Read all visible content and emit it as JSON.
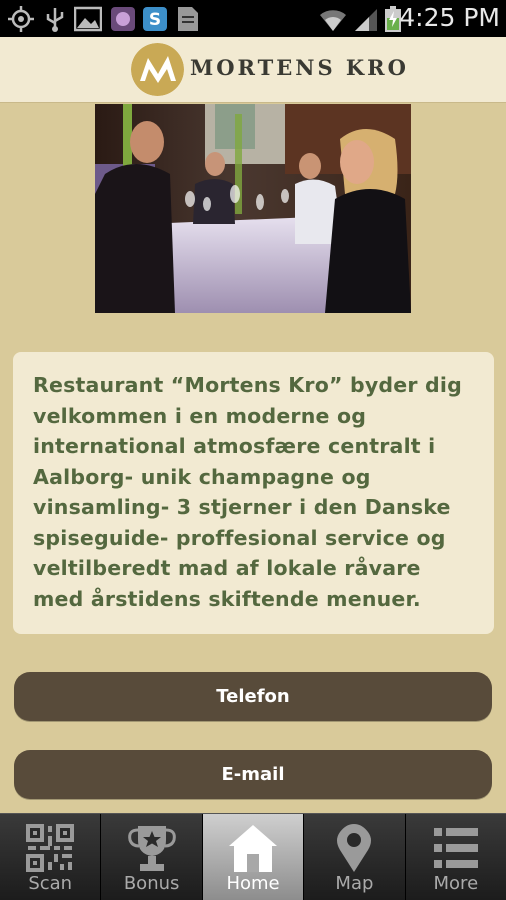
{
  "status_bar": {
    "time": "4:25 PM",
    "icons": [
      "gps-icon",
      "usb-icon",
      "gallery-icon",
      "app-icon",
      "skype-icon",
      "file-icon",
      "wifi-icon",
      "signal-icon",
      "battery-icon"
    ]
  },
  "header": {
    "logo_text": "MORTENS KRO"
  },
  "hero": {
    "image_name": "restaurant-photo"
  },
  "intro": {
    "text": "Restaurant “Mortens Kro” byder dig velkommen i en moderne og international atmosfære centralt i Aalborg- unik champagne og vinsamling- 3 stjerner i den Danske spiseguide- proffesional service og veltilberedt mad af lokale råvare med årstidens skiftende menuer."
  },
  "buttons": {
    "telefon": "Telefon",
    "email": "E-mail"
  },
  "tabs": [
    {
      "label": "Scan",
      "icon": "qr-code-icon",
      "active": false
    },
    {
      "label": "Bonus",
      "icon": "trophy-icon",
      "active": false
    },
    {
      "label": "Home",
      "icon": "home-icon",
      "active": true
    },
    {
      "label": "Map",
      "icon": "map-pin-icon",
      "active": false
    },
    {
      "label": "More",
      "icon": "list-icon",
      "active": false
    }
  ],
  "colors": {
    "background": "#d9ca9a",
    "card": "#f2ead2",
    "text_green": "#54683f",
    "button": "#584b3a",
    "logo_gold": "#c9a955"
  }
}
